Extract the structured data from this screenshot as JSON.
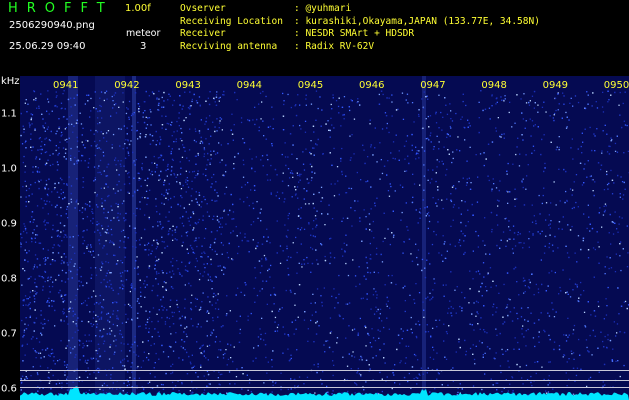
{
  "header": {
    "app_name": "HROFFT",
    "version": "1.00f",
    "filename": "2506290940.png",
    "datetime": "25.06.29 09:40",
    "mode_label": "meteor",
    "mode_count": "3",
    "info": [
      {
        "key": "Ovserver",
        "value": ": @yuhmari"
      },
      {
        "key": "Receiving Location",
        "value": ": kurashiki,Okayama,JAPAN (133.77E, 34.58N)"
      },
      {
        "key": "Receiver",
        "value": ": NESDR SMArt + HDSDR"
      },
      {
        "key": "Recviving antenna",
        "value": ": Radix RV-62V"
      }
    ]
  },
  "axis": {
    "unit": "kHz",
    "ticks": [
      "1.1",
      "1.0",
      "0.9",
      "0.8",
      "0.7",
      "0.6"
    ],
    "tick_values": [
      1.1,
      1.0,
      0.9,
      0.8,
      0.7,
      0.6
    ],
    "range": [
      0.58,
      1.17
    ]
  },
  "time_labels": [
    "0941",
    "0942",
    "0943",
    "0944",
    "0945",
    "0946",
    "0947",
    "0948",
    "0949",
    "0950"
  ],
  "colors": {
    "background": "#050a52",
    "signal_line": "#00e5ff",
    "accent_green": "#22ff22",
    "accent_yellow": "#ffff33"
  }
}
